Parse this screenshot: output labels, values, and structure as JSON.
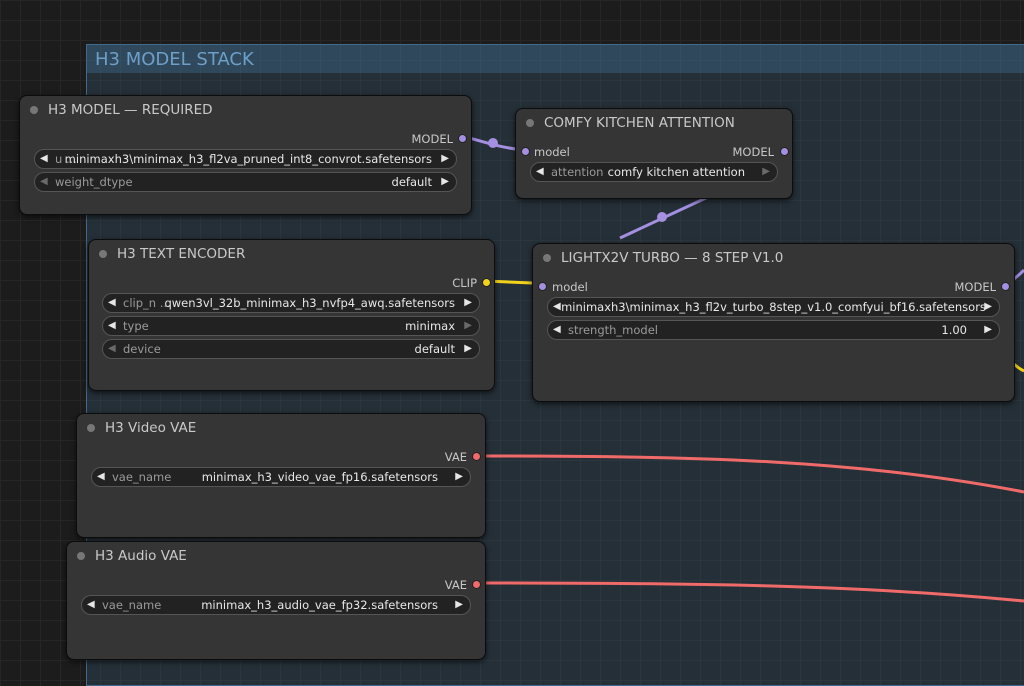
{
  "colors": {
    "model_wire": "#a48fe0",
    "clip_wire": "#f2d21b",
    "vae_wire": "#f06a6a",
    "group_title": "#6d9fc9"
  },
  "group": {
    "title": "H3 MODEL STACK"
  },
  "nodes": {
    "model_required": {
      "title": "H3 MODEL — REQUIRED",
      "output": "MODEL",
      "widgets": [
        {
          "name": "u ...",
          "value": "minimaxh3\\minimax_h3_fl2va_pruned_int8_convrot.safetensors"
        },
        {
          "name": "weight_dtype",
          "value": "default"
        }
      ]
    },
    "comfy_kitchen": {
      "title": "COMFY KITCHEN ATTENTION",
      "input": "model",
      "output": "MODEL",
      "widgets": [
        {
          "name": "attention",
          "value": "comfy kitchen attention"
        }
      ]
    },
    "text_encoder": {
      "title": "H3 TEXT ENCODER",
      "output": "CLIP",
      "widgets": [
        {
          "name": "clip_n ...",
          "value": "qwen3vl_32b_minimax_h3_nvfp4_awq.safetensors"
        },
        {
          "name": "type",
          "value": "minimax"
        },
        {
          "name": "device",
          "value": "default"
        }
      ]
    },
    "lightx2v": {
      "title": "LIGHTX2V TURBO — 8 STEP V1.0",
      "input": "model",
      "output": "MODEL",
      "widgets": [
        {
          "name": "",
          "value": "minimaxh3\\minimax_h3_fl2v_turbo_8step_v1.0_comfyui_bf16.safetensors"
        },
        {
          "name": "strength_model",
          "value": "1.00"
        }
      ]
    },
    "video_vae": {
      "title": "H3 Video VAE",
      "output": "VAE",
      "widgets": [
        {
          "name": "vae_name",
          "value": "minimax_h3_video_vae_fp16.safetensors"
        }
      ]
    },
    "audio_vae": {
      "title": "H3 Audio VAE",
      "output": "VAE",
      "widgets": [
        {
          "name": "vae_name",
          "value": "minimax_h3_audio_vae_fp32.safetensors"
        }
      ]
    }
  },
  "icons": {
    "arrow_left": "◀",
    "arrow_right": "▶"
  }
}
